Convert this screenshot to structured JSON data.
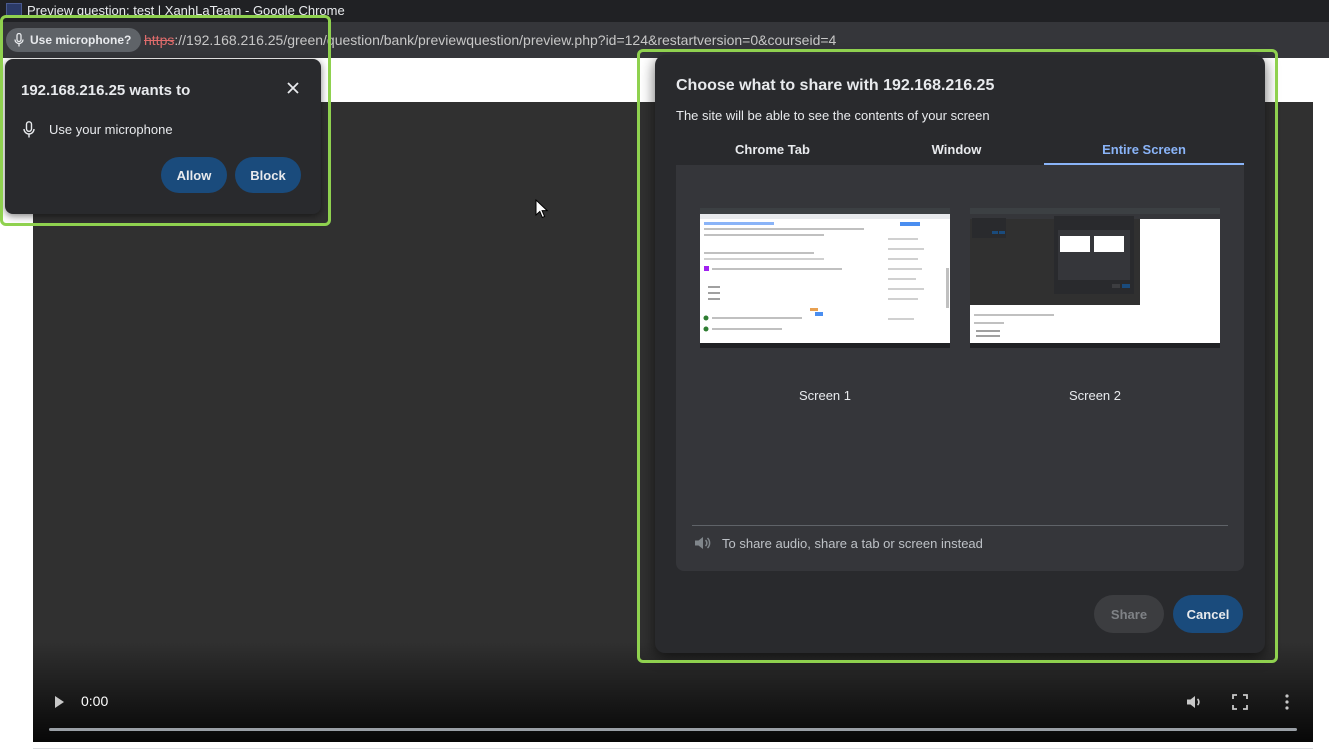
{
  "window": {
    "title": "Preview question: test | XanhLaTeam - Google Chrome"
  },
  "addressbar": {
    "mic_chip_label": "Use microphone?",
    "url_scheme": "https",
    "url_rest": "://192.168.216.25/green/question/bank/previewquestion/preview.php?id=124&restartversion=0&courseid=4"
  },
  "permission": {
    "heading": "192.168.216.25 wants to",
    "mic_label": "Use your microphone",
    "allow_label": "Allow",
    "block_label": "Block"
  },
  "share_dialog": {
    "heading": "Choose what to share with 192.168.216.25",
    "subtext": "The site will be able to see the contents of your screen",
    "tabs": [
      {
        "label": "Chrome Tab",
        "selected": false
      },
      {
        "label": "Window",
        "selected": false
      },
      {
        "label": "Entire Screen",
        "selected": true
      }
    ],
    "screens": [
      {
        "label": "Screen 1"
      },
      {
        "label": "Screen 2"
      }
    ],
    "audio_note": "To share audio, share a tab or screen instead",
    "share_label": "Share",
    "cancel_label": "Cancel"
  },
  "video": {
    "time": "0:00"
  },
  "colors": {
    "highlight": "#8fd14f",
    "accent": "#8ab4f8",
    "button_blue": "#1a4b7c",
    "dialog_bg": "#292a2d"
  }
}
